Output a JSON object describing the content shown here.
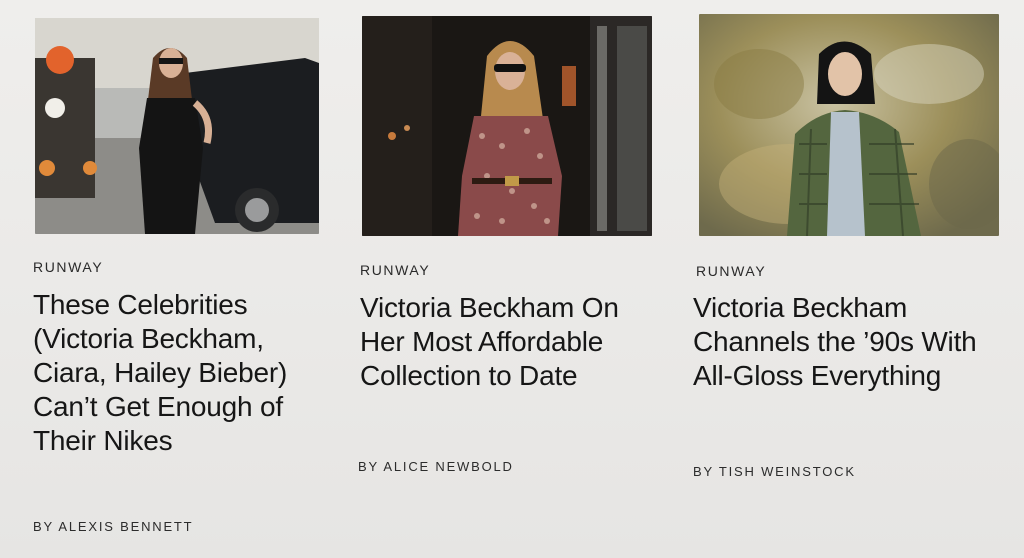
{
  "articles": [
    {
      "category": "RUNWAY",
      "headline": "These Celebrities (Victoria Beckham, Ciara, Hailey Bieber) Can’t Get Enough of Their Nikes",
      "byline": "BY ALEXIS BENNETT"
    },
    {
      "category": "RUNWAY",
      "headline": "Victoria Beckham On Her Most Affordable Collection to Date",
      "byline": "BY ALICE NEWBOLD"
    },
    {
      "category": "RUNWAY",
      "headline": "Victoria Beckham Channels the ’90s With All-Gloss Everything",
      "byline": "BY TISH WEINSTOCK"
    }
  ],
  "colors": {
    "background": "#ecebe9",
    "text": "#161616"
  }
}
